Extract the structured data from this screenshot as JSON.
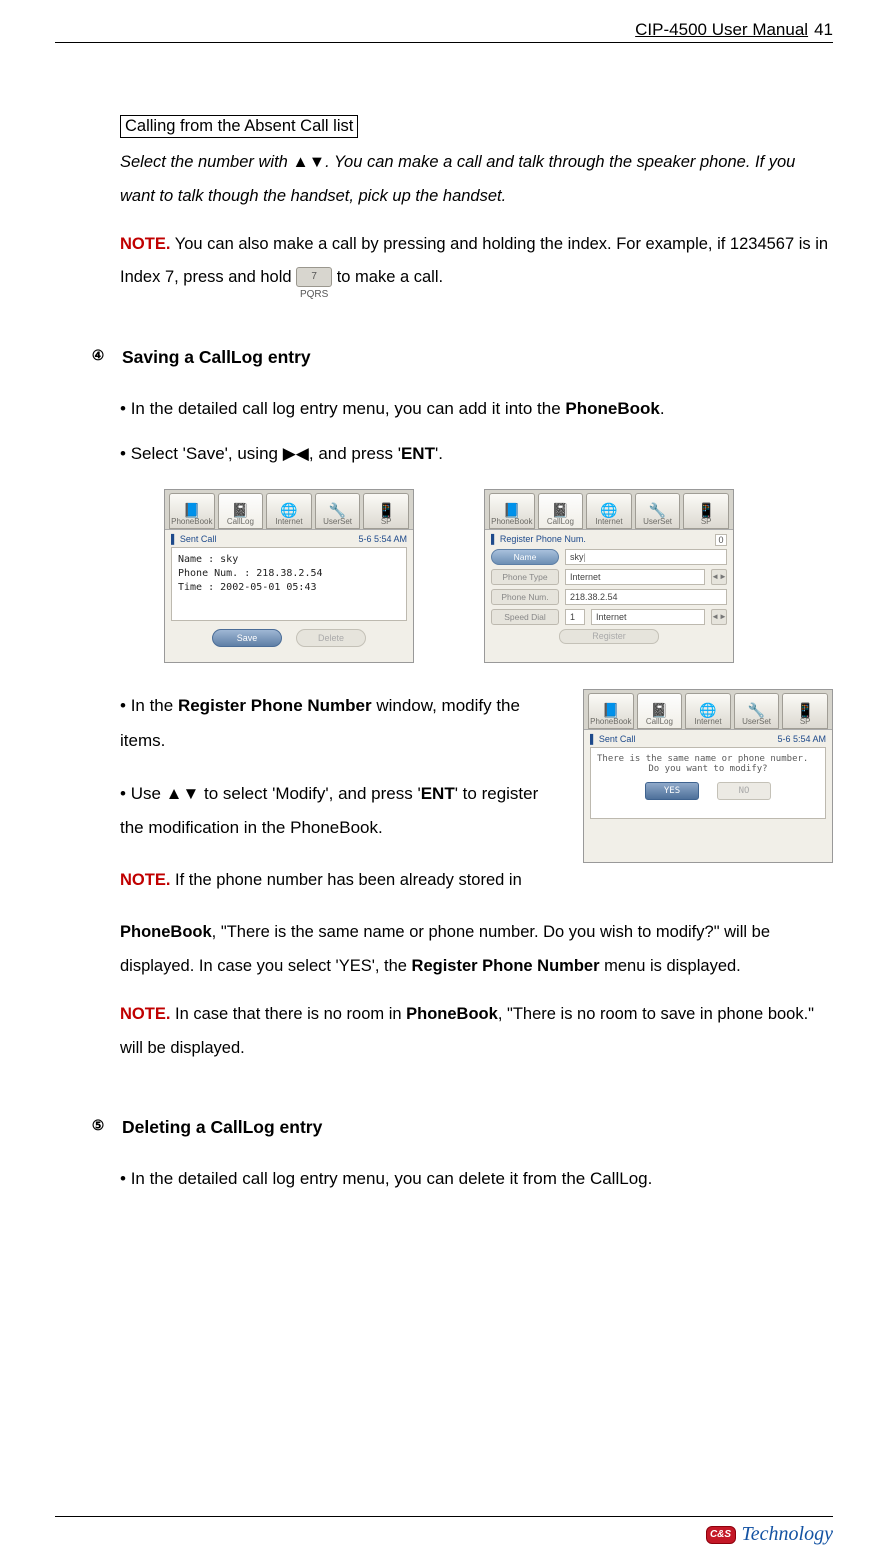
{
  "header": {
    "title": "CIP-4500 User Manual",
    "page": "41"
  },
  "intro": {
    "boxed_title": "Calling from the Absent Call list",
    "line1_a": "Select the number with ",
    "arrows_ud": "▲▼",
    "line1_b": ". You can make a call and talk through the speaker phone. If you want to talk though the handset, pick up the handset.",
    "note_label": "NOTE.",
    "note_text_a": " You can also make a call by pressing and holding the index. For example, if 1234567 is in Index 7, press and hold ",
    "key7_label": "7 PQRS",
    "note_text_b": " to make a call."
  },
  "section4": {
    "num": "④",
    "title": "Saving a CallLog entry",
    "p1_a": "In the detailed call log entry menu, you can add it into the ",
    "p1_b": "PhoneBook",
    "p1_c": ".",
    "p2_a": "Select 'Save', using ",
    "arrows_lr": "▶◀",
    "p2_b": ", and press '",
    "p2_c": "ENT",
    "p2_d": "'.",
    "p3_a": "In the ",
    "p3_b": "Register Phone Number",
    "p3_c": " window, modify the items.",
    "p4_a": "Use ",
    "arrows_ud2": "▲▼",
    "p4_b": " to select 'Modify', and press '",
    "p4_c": "ENT",
    "p4_d": "' to register the modification in the PhoneBook.",
    "note1_label": "NOTE.",
    "note1_a": " If the phone number has been already stored in ",
    "note1_b": "PhoneBook",
    "note1_c": ", \"There is the same name or phone number. Do you wish to modify?\" will be displayed. In case you select 'YES', the ",
    "note1_d": "Register Phone Number",
    "note1_e": " menu is displayed.",
    "note2_label": "NOTE.",
    "note2_a": " In case that there is no room in ",
    "note2_b": "PhoneBook",
    "note2_c": ", \"There is no room to save in phone book.\"  will be displayed."
  },
  "section5": {
    "num": "⑤",
    "title": "Deleting a CallLog entry",
    "p1": "In the detailed call log entry menu, you can delete it from the CallLog."
  },
  "screenshots": {
    "tabs": [
      "PhoneBook",
      "CallLog",
      "Internet",
      "UserSet",
      "SP"
    ],
    "tab_icons": [
      "📘",
      "📓",
      "🌐",
      "🔧",
      "📱"
    ],
    "sc1": {
      "title": "Sent Call",
      "time": "5-6  5:54 AM",
      "name_label": "Name : ",
      "name": "sky",
      "num_label": "Phone Num. : ",
      "num": "218.38.2.54",
      "time_label": "Time : ",
      "time_val": "2002-05-01 05:43",
      "save": "Save",
      "delete": "Delete"
    },
    "sc2": {
      "title": "Register Phone Num.",
      "corner": "0",
      "name_label": "Name",
      "name_val": "sky",
      "type_label": "Phone Type",
      "type_val": "Internet",
      "num_label": "Phone Num.",
      "num_val": "218.38.2.54",
      "sd_label": "Speed Dial",
      "sd_val": "1",
      "sd_type": "Internet",
      "register": "Register"
    },
    "sc3": {
      "title": "Sent Call",
      "time": "5-6  5:54 AM",
      "msg1": "There is the same name or phone number.",
      "msg2": "Do you want to modify?",
      "yes": "YES",
      "no": "NO"
    }
  },
  "footer": {
    "badge": "C&S",
    "brand": "Technology"
  }
}
